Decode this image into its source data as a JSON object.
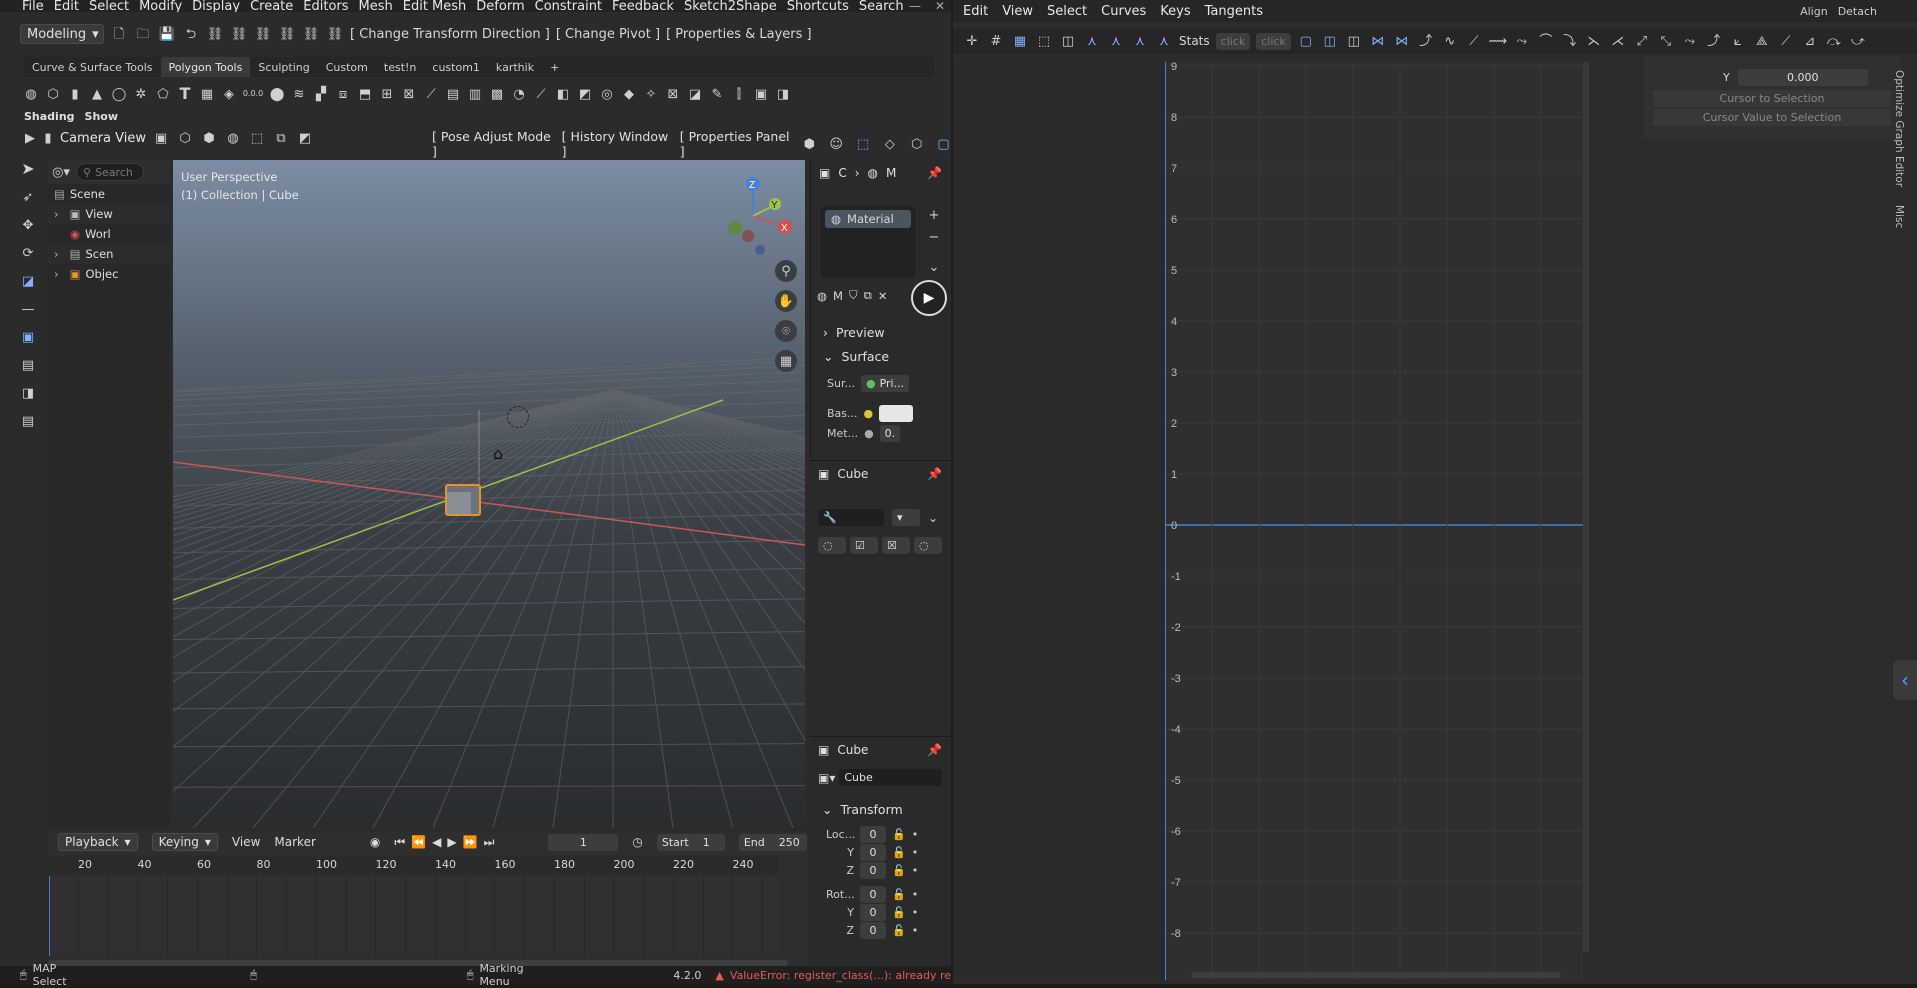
{
  "left_window": {
    "menu": [
      "File",
      "Edit",
      "Select",
      "Modify",
      "Display",
      "Create",
      "Editors",
      "Mesh",
      "Edit Mesh",
      "Deform",
      "Constraint",
      "Feedback",
      "Sketch2Shape",
      "Shortcuts",
      "Search"
    ],
    "mode_select": "Modeling",
    "menu_buttons": [
      "[ Change Transform Direction ]",
      "[ Change Pivot ]",
      "[ Properties & Layers ]"
    ],
    "workspace_tabs": [
      "Curve & Surface Tools",
      "Polygon Tools",
      "Sculpting",
      "Custom",
      "test!n",
      "custom1",
      "karthik",
      "+"
    ],
    "active_tab": "Polygon Tools",
    "shading_label": "Shading",
    "show_label": "Show",
    "camera_view": "Camera View",
    "viewport_buttons": [
      "[ Pose Adjust Mode ]",
      "[ History Window ]",
      "[ Properties Panel ]"
    ],
    "snap_value": "0.0.0"
  },
  "outliner": {
    "search_placeholder": "Search",
    "items": [
      "Scene",
      "View",
      "Worl",
      "Scen",
      "Objec"
    ]
  },
  "viewport": {
    "title": "User Perspective",
    "subtitle": "(1) Collection | Cube",
    "gizmo": {
      "x": "X",
      "y": "Y",
      "z": "Z"
    }
  },
  "properties_top": {
    "breadcrumb": [
      "C",
      "M"
    ],
    "material_slot": "Material",
    "material_name": "M",
    "sections": [
      "Preview",
      "Surface"
    ],
    "surface_label": "Sur...",
    "surface_value": "Pri...",
    "base_label": "Bas...",
    "metal_label": "Met...",
    "metal_value": "0."
  },
  "properties_mid": {
    "title": "Cube"
  },
  "properties_bottom": {
    "title": "Cube",
    "object_name": "Cube",
    "section": "Transform",
    "loc_label": "Loc...",
    "rot_label": "Rot...",
    "axis_y": "Y",
    "axis_z": "Z",
    "zero": "0"
  },
  "timeline": {
    "menus": [
      "Playback",
      "Keying",
      "View",
      "Marker"
    ],
    "current_frame": "1",
    "start_label": "Start",
    "start": "1",
    "end_label": "End",
    "end": "250",
    "ruler": [
      "20",
      "40",
      "60",
      "80",
      "100",
      "120",
      "140",
      "160",
      "180",
      "200",
      "220",
      "240"
    ]
  },
  "status_bar": {
    "left": "MAP Select",
    "middle": "Marking Menu",
    "version": "4.2.0",
    "error": "ValueError: register_class(...): already re"
  },
  "right_window": {
    "menu": [
      "Edit",
      "View",
      "Select",
      "Curves",
      "Keys",
      "Tangents"
    ],
    "stats": "Stats",
    "click1": "click",
    "click2": "click",
    "top_right": [
      "Align",
      "Detach"
    ],
    "graph_y_labels": [
      "9",
      "8",
      "7",
      "6",
      "5",
      "4",
      "3",
      "2",
      "1",
      "0",
      "-1",
      "-2",
      "-3",
      "-4",
      "-5",
      "-6",
      "-7",
      "-8"
    ],
    "panel_y_label": "Y",
    "panel_y_value": "0.000",
    "cursor_to_selection": "Cursor to Selection",
    "cursor_value_to_selection": "Cursor Value to Selection",
    "side_tabs": [
      "Optimize Graph Editor",
      "Misc"
    ]
  },
  "colors": {
    "accent_blue": "#4a7fd4",
    "x_axis": "#c9565a",
    "y_axis": "#9ec24a",
    "selection_orange": "#e8922c",
    "error_red": "#e85a5a"
  }
}
